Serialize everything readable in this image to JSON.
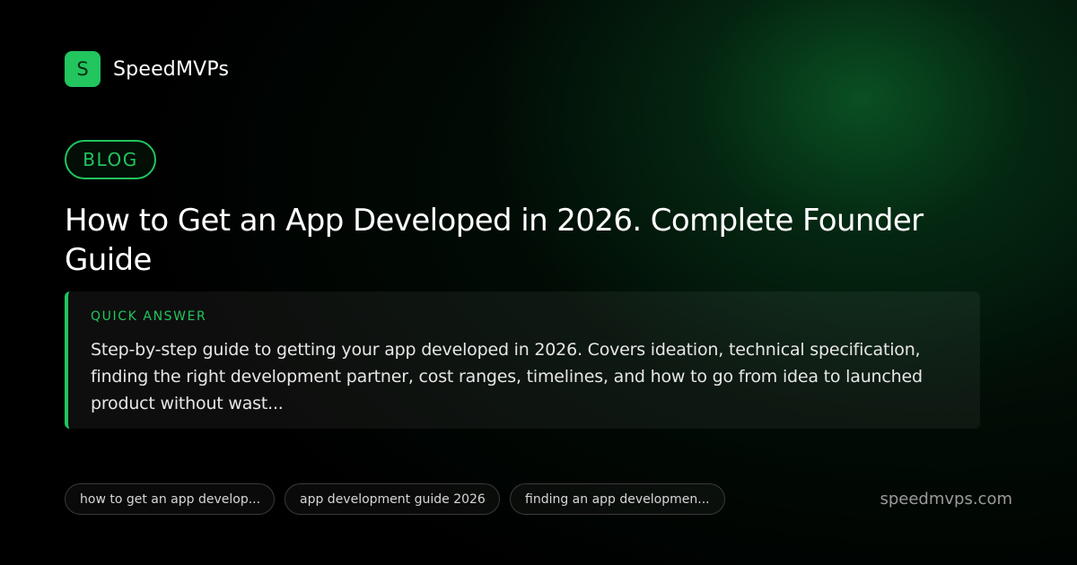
{
  "brand": {
    "logo_letter": "S",
    "name": "SpeedMVPs"
  },
  "badge": {
    "label": "BLOG"
  },
  "title": "How to Get an App Developed in 2026. Complete Founder Guide",
  "quick_answer": {
    "label": "QUICK ANSWER",
    "text": "Step-by-step guide to getting your app developed in 2026. Covers ideation, technical specification, finding the right development partner,  cost ranges, timelines, and how to go from idea to launched product without wast..."
  },
  "tags": [
    {
      "label": "how to get an app develop..."
    },
    {
      "label": "app development guide 2026"
    },
    {
      "label": "finding an app developmen..."
    }
  ],
  "footer": {
    "url": "speedmvps.com"
  },
  "colors": {
    "accent": "#22c55e",
    "background": "#000000",
    "glow": "#0c602a"
  }
}
